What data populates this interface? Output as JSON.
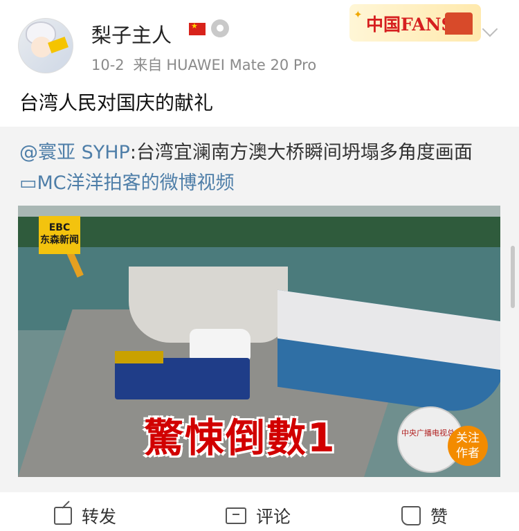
{
  "post": {
    "username": "梨子主人",
    "date": "10-2",
    "source_prefix": "来自",
    "device": "HUAWEI Mate 20 Pro",
    "badge_text": "中国FANS",
    "text": "台湾人民对国庆的献礼"
  },
  "repost": {
    "mention": "@寰亚 SYHP",
    "text_rest": ":台湾宜澜南方澳大桥瞬间坍塌多角度画面",
    "video_link": "MC洋洋拍客的微博视频",
    "video": {
      "channel_logo": "EBC\n东森新闻",
      "overlay_text": "驚悚倒數1",
      "cmg_text": "中央广播电视总台 China Media Group",
      "follow_label": "关注\n作者"
    }
  },
  "actions": {
    "share": "转发",
    "comment": "评论",
    "like": "赞"
  },
  "colors": {
    "link": "#4e7ea8",
    "overlay_red": "#d10000",
    "follow_orange": "#f38b00"
  }
}
